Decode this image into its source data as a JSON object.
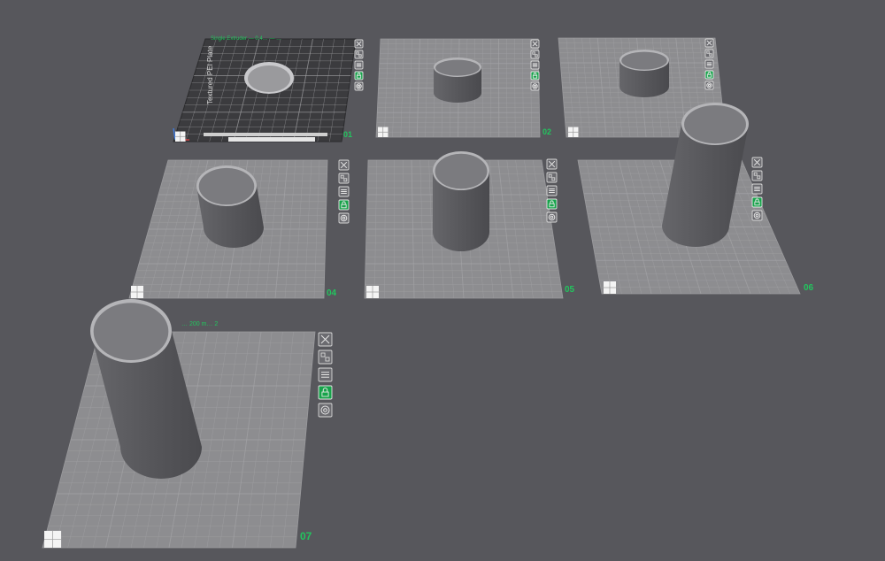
{
  "app": {
    "view": "plate-overview",
    "colors": {
      "background": "#57575c",
      "plate_surface": "#8d8d90",
      "plate_grid": "#a4a4a7",
      "label_green": "#22c55e",
      "active_button": "#16a34a",
      "cylinder_body": "#56565a",
      "cylinder_rim": "#b5b5b8",
      "cylinder_inner": "#7b7b7f",
      "textured_plate": "#3b3b3e"
    }
  },
  "plate_toolbar_icons": [
    "close-icon",
    "arrange-icon",
    "settings-icon",
    "lock-icon",
    "orient-icon"
  ],
  "plates": [
    {
      "number": "01",
      "label": "Single Extruder — 0.4… — … ",
      "label_short": "",
      "textured": true,
      "bed_mark": "Textured PEI Plate",
      "brand_mark": "",
      "active_button": 3
    },
    {
      "number": "02",
      "label": "",
      "textured": false,
      "active_button": 3
    },
    {
      "number": "03",
      "label": "",
      "textured": false,
      "active_button": 3
    },
    {
      "number": "04",
      "label": "",
      "textured": false,
      "active_button": 3
    },
    {
      "number": "05",
      "label": "",
      "textured": false,
      "active_button": 3
    },
    {
      "number": "06",
      "label": "",
      "textured": false,
      "active_button": 3
    },
    {
      "number": "07",
      "label": "… 200 m… 2",
      "textured": false,
      "active_button": 3
    }
  ]
}
